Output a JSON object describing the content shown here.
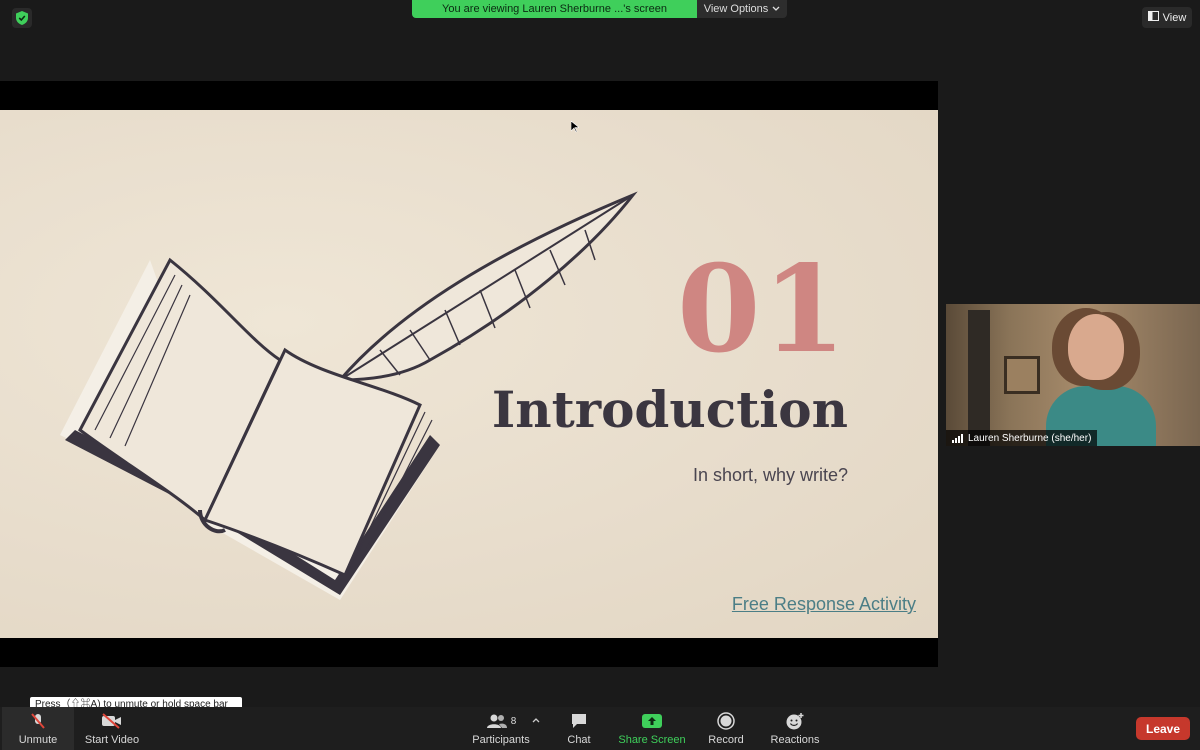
{
  "top": {
    "share_notice": "You are viewing Lauren Sherburne ...'s screen",
    "view_options_label": "View Options",
    "view_label": "View"
  },
  "slide": {
    "number": "01",
    "title": "Introduction",
    "subtitle": "In short, why write?",
    "link": "Free Response Activity"
  },
  "video": {
    "participant_name": "Lauren Sherburne (she/her)"
  },
  "tooltip": {
    "text": "Press（⇧⌘A) to unmute or hold space bar to temporarily unmute."
  },
  "toolbar": {
    "unmute_label": "Unmute",
    "start_video_label": "Start Video",
    "participants_label": "Participants",
    "participants_count": "8",
    "chat_label": "Chat",
    "share_screen_label": "Share Screen",
    "record_label": "Record",
    "reactions_label": "Reactions",
    "leave_label": "Leave"
  },
  "colors": {
    "banner_green": "#3fcf5b",
    "share_green": "#3fcf5b",
    "leave_red": "#c6382c",
    "slide_number": "#cf8682",
    "link_teal": "#4b7e86"
  }
}
